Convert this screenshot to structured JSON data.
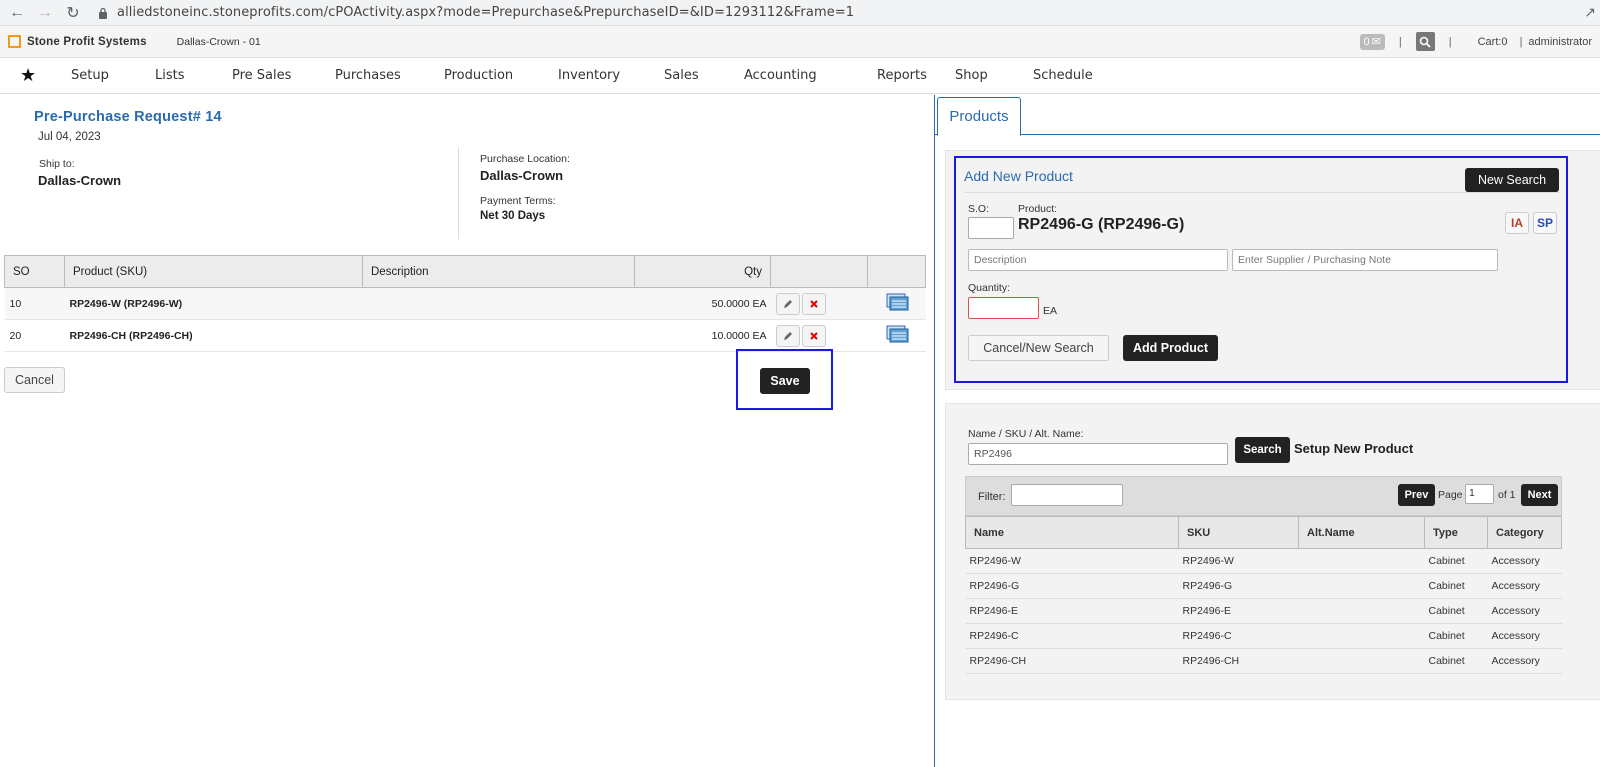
{
  "browser": {
    "url": "alliedstoneinc.stoneprofits.com/cPOActivity.aspx?mode=Prepurchase&PrepurchaseID=&ID=1293112&Frame=1"
  },
  "header": {
    "brand": "Stone Profit Systems",
    "location": "Dallas-Crown - 01",
    "message_count": "0",
    "cart": "Cart:0",
    "user": "administrator"
  },
  "nav": {
    "items": [
      "Setup",
      "Lists",
      "Pre Sales",
      "Purchases",
      "Production",
      "Inventory",
      "Sales",
      "Accounting",
      "Reports",
      "Shop",
      "Schedule"
    ]
  },
  "request": {
    "title": "Pre-Purchase Request# 14",
    "date": "Jul 04, 2023",
    "ship_to_label": "Ship to:",
    "ship_to": "Dallas-Crown",
    "purchase_location_label": "Purchase Location:",
    "purchase_location": "Dallas-Crown",
    "payment_terms_label": "Payment Terms:",
    "payment_terms": "Net 30 Days"
  },
  "items_table": {
    "headers": [
      "SO",
      "Product (SKU)",
      "Description",
      "Qty"
    ],
    "rows": [
      {
        "so": "10",
        "product": "RP2496-W (RP2496-W)",
        "description": "",
        "qty": "50.0000 EA"
      },
      {
        "so": "20",
        "product": "RP2496-CH (RP2496-CH)",
        "description": "",
        "qty": "10.0000 EA"
      }
    ]
  },
  "actions": {
    "cancel": "Cancel",
    "save": "Save"
  },
  "products_panel": {
    "tab": "Products",
    "add_title": "Add New Product",
    "new_search": "New Search",
    "so_label": "S.O:",
    "product_label": "Product:",
    "product_value": "RP2496-G (RP2496-G)",
    "ia": "IA",
    "sp": "SP",
    "description_placeholder": "Description",
    "supplier_placeholder": "Enter Supplier / Purchasing Note",
    "quantity_label": "Quantity:",
    "unit": "EA",
    "cancel_new_search": "Cancel/New Search",
    "add_product": "Add Product"
  },
  "search": {
    "label": "Name / SKU / Alt. Name:",
    "value": "RP2496",
    "button": "Search",
    "setup_new": "Setup New Product",
    "filter_label": "Filter:",
    "prev": "Prev",
    "page_label": "Page",
    "page": "1",
    "of": "of 1",
    "next": "Next",
    "headers": [
      "Name",
      "SKU",
      "Alt.Name",
      "Type",
      "Category"
    ],
    "rows": [
      {
        "name": "RP2496-W",
        "sku": "RP2496-W",
        "alt": "",
        "type": "Cabinet",
        "category": "Accessory"
      },
      {
        "name": "RP2496-G",
        "sku": "RP2496-G",
        "alt": "",
        "type": "Cabinet",
        "category": "Accessory"
      },
      {
        "name": "RP2496-E",
        "sku": "RP2496-E",
        "alt": "",
        "type": "Cabinet",
        "category": "Accessory"
      },
      {
        "name": "RP2496-C",
        "sku": "RP2496-C",
        "alt": "",
        "type": "Cabinet",
        "category": "Accessory"
      },
      {
        "name": "RP2496-CH",
        "sku": "RP2496-CH",
        "alt": "",
        "type": "Cabinet",
        "category": "Accessory"
      }
    ]
  }
}
